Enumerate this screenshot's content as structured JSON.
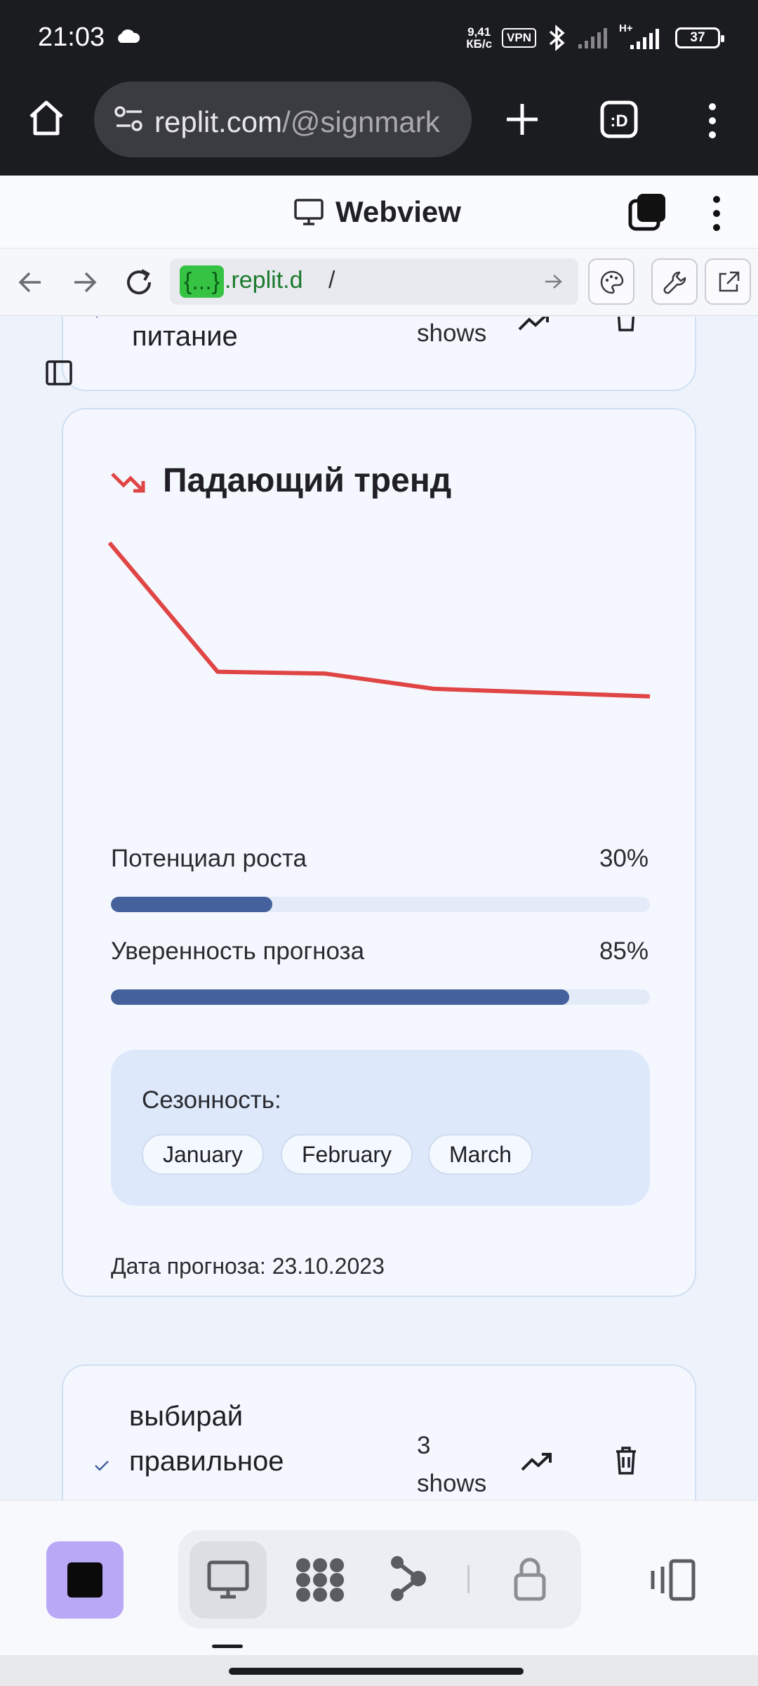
{
  "status_bar": {
    "time": "21:03",
    "net_speed_value": "9,41",
    "net_speed_unit": "КБ/с",
    "vpn": "VPN",
    "network_type": "H+",
    "battery": "37"
  },
  "browser": {
    "url_main": "replit.com",
    "url_rest": "/@signmark"
  },
  "webview": {
    "title": "Webview",
    "address": {
      "tag": "{...}",
      "domain": ".replit.d",
      "path": "/"
    }
  },
  "previous_card": {
    "title": "питание",
    "shows": "shows"
  },
  "trend_card": {
    "title": "Падающий тренд",
    "colors": {
      "trend": "#e04545",
      "bar": "#44619c"
    },
    "chart_data": {
      "type": "line",
      "x": [
        1,
        2,
        3,
        4,
        5,
        6
      ],
      "series": [
        {
          "values": [
            100,
            32,
            31,
            23,
            21,
            19
          ]
        }
      ],
      "ylim": [
        0,
        100
      ],
      "grid": false
    },
    "metrics": [
      {
        "label": "Потенциал роста",
        "value": "30%",
        "fraction": 0.3
      },
      {
        "label": "Уверенность прогноза",
        "value": "85%",
        "fraction": 0.85
      }
    ],
    "seasonality": {
      "label": "Сезонность:",
      "months": [
        "January",
        "February",
        "March"
      ]
    },
    "forecast_date": "Дата прогноза: 23.10.2023"
  },
  "next_card": {
    "title_line1": "выбирай",
    "title_line2": "правильное",
    "count": "3",
    "shows": "shows"
  },
  "bottom_nav": {
    "items": [
      "monitor-icon",
      "apps-icon",
      "branch-icon",
      "lock-icon"
    ]
  }
}
